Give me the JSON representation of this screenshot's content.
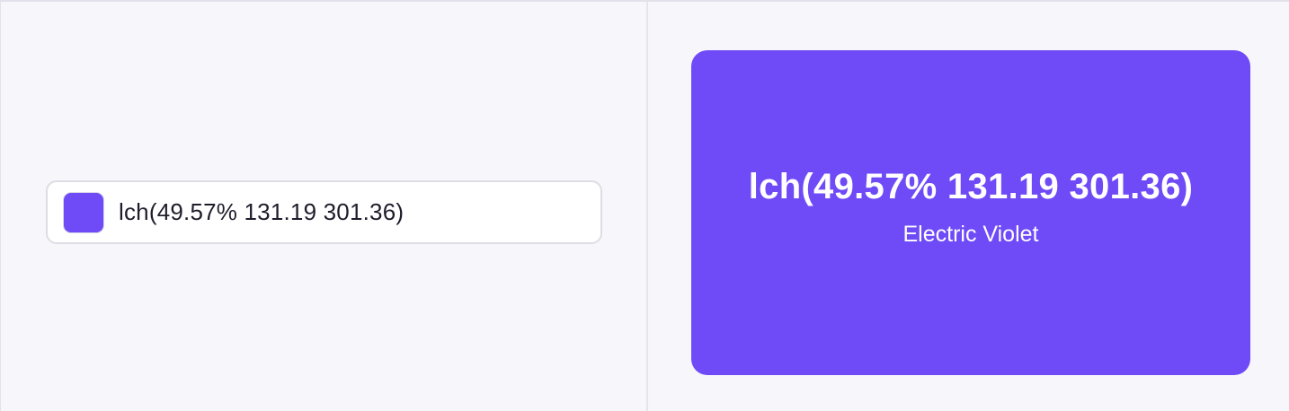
{
  "input": {
    "value": "lch(49.57% 131.19 301.36)",
    "swatch_color": "#6f4af7"
  },
  "preview": {
    "value": "lch(49.57% 131.19 301.36)",
    "name": "Electric Violet",
    "background_color": "#6f4af7",
    "text_color": "#ffffff"
  }
}
